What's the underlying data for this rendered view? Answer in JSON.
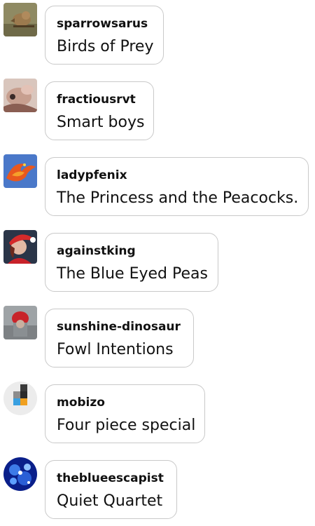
{
  "replies": [
    {
      "username": "sparrowsarus",
      "text": "Birds of Prey",
      "avatar_icon": "sparrow-photo-icon"
    },
    {
      "username": "fractiousrvt",
      "text": "Smart boys",
      "avatar_icon": "rat-photo-icon"
    },
    {
      "username": "ladypfenix",
      "text": "The Princess and the Peacocks.",
      "avatar_icon": "phoenix-art-icon"
    },
    {
      "username": "againstking",
      "text": "The Blue Eyed Peas",
      "avatar_icon": "santa-hat-person-icon"
    },
    {
      "username": "sunshine-dinosaur",
      "text": "Fowl Intentions",
      "avatar_icon": "red-hat-figure-icon"
    },
    {
      "username": "mobizo",
      "text": "Four piece special",
      "avatar_icon": "pixel-blocks-icon"
    },
    {
      "username": "theblueescapist",
      "text": "Quiet Quartet",
      "avatar_icon": "blue-crystal-icon"
    }
  ]
}
